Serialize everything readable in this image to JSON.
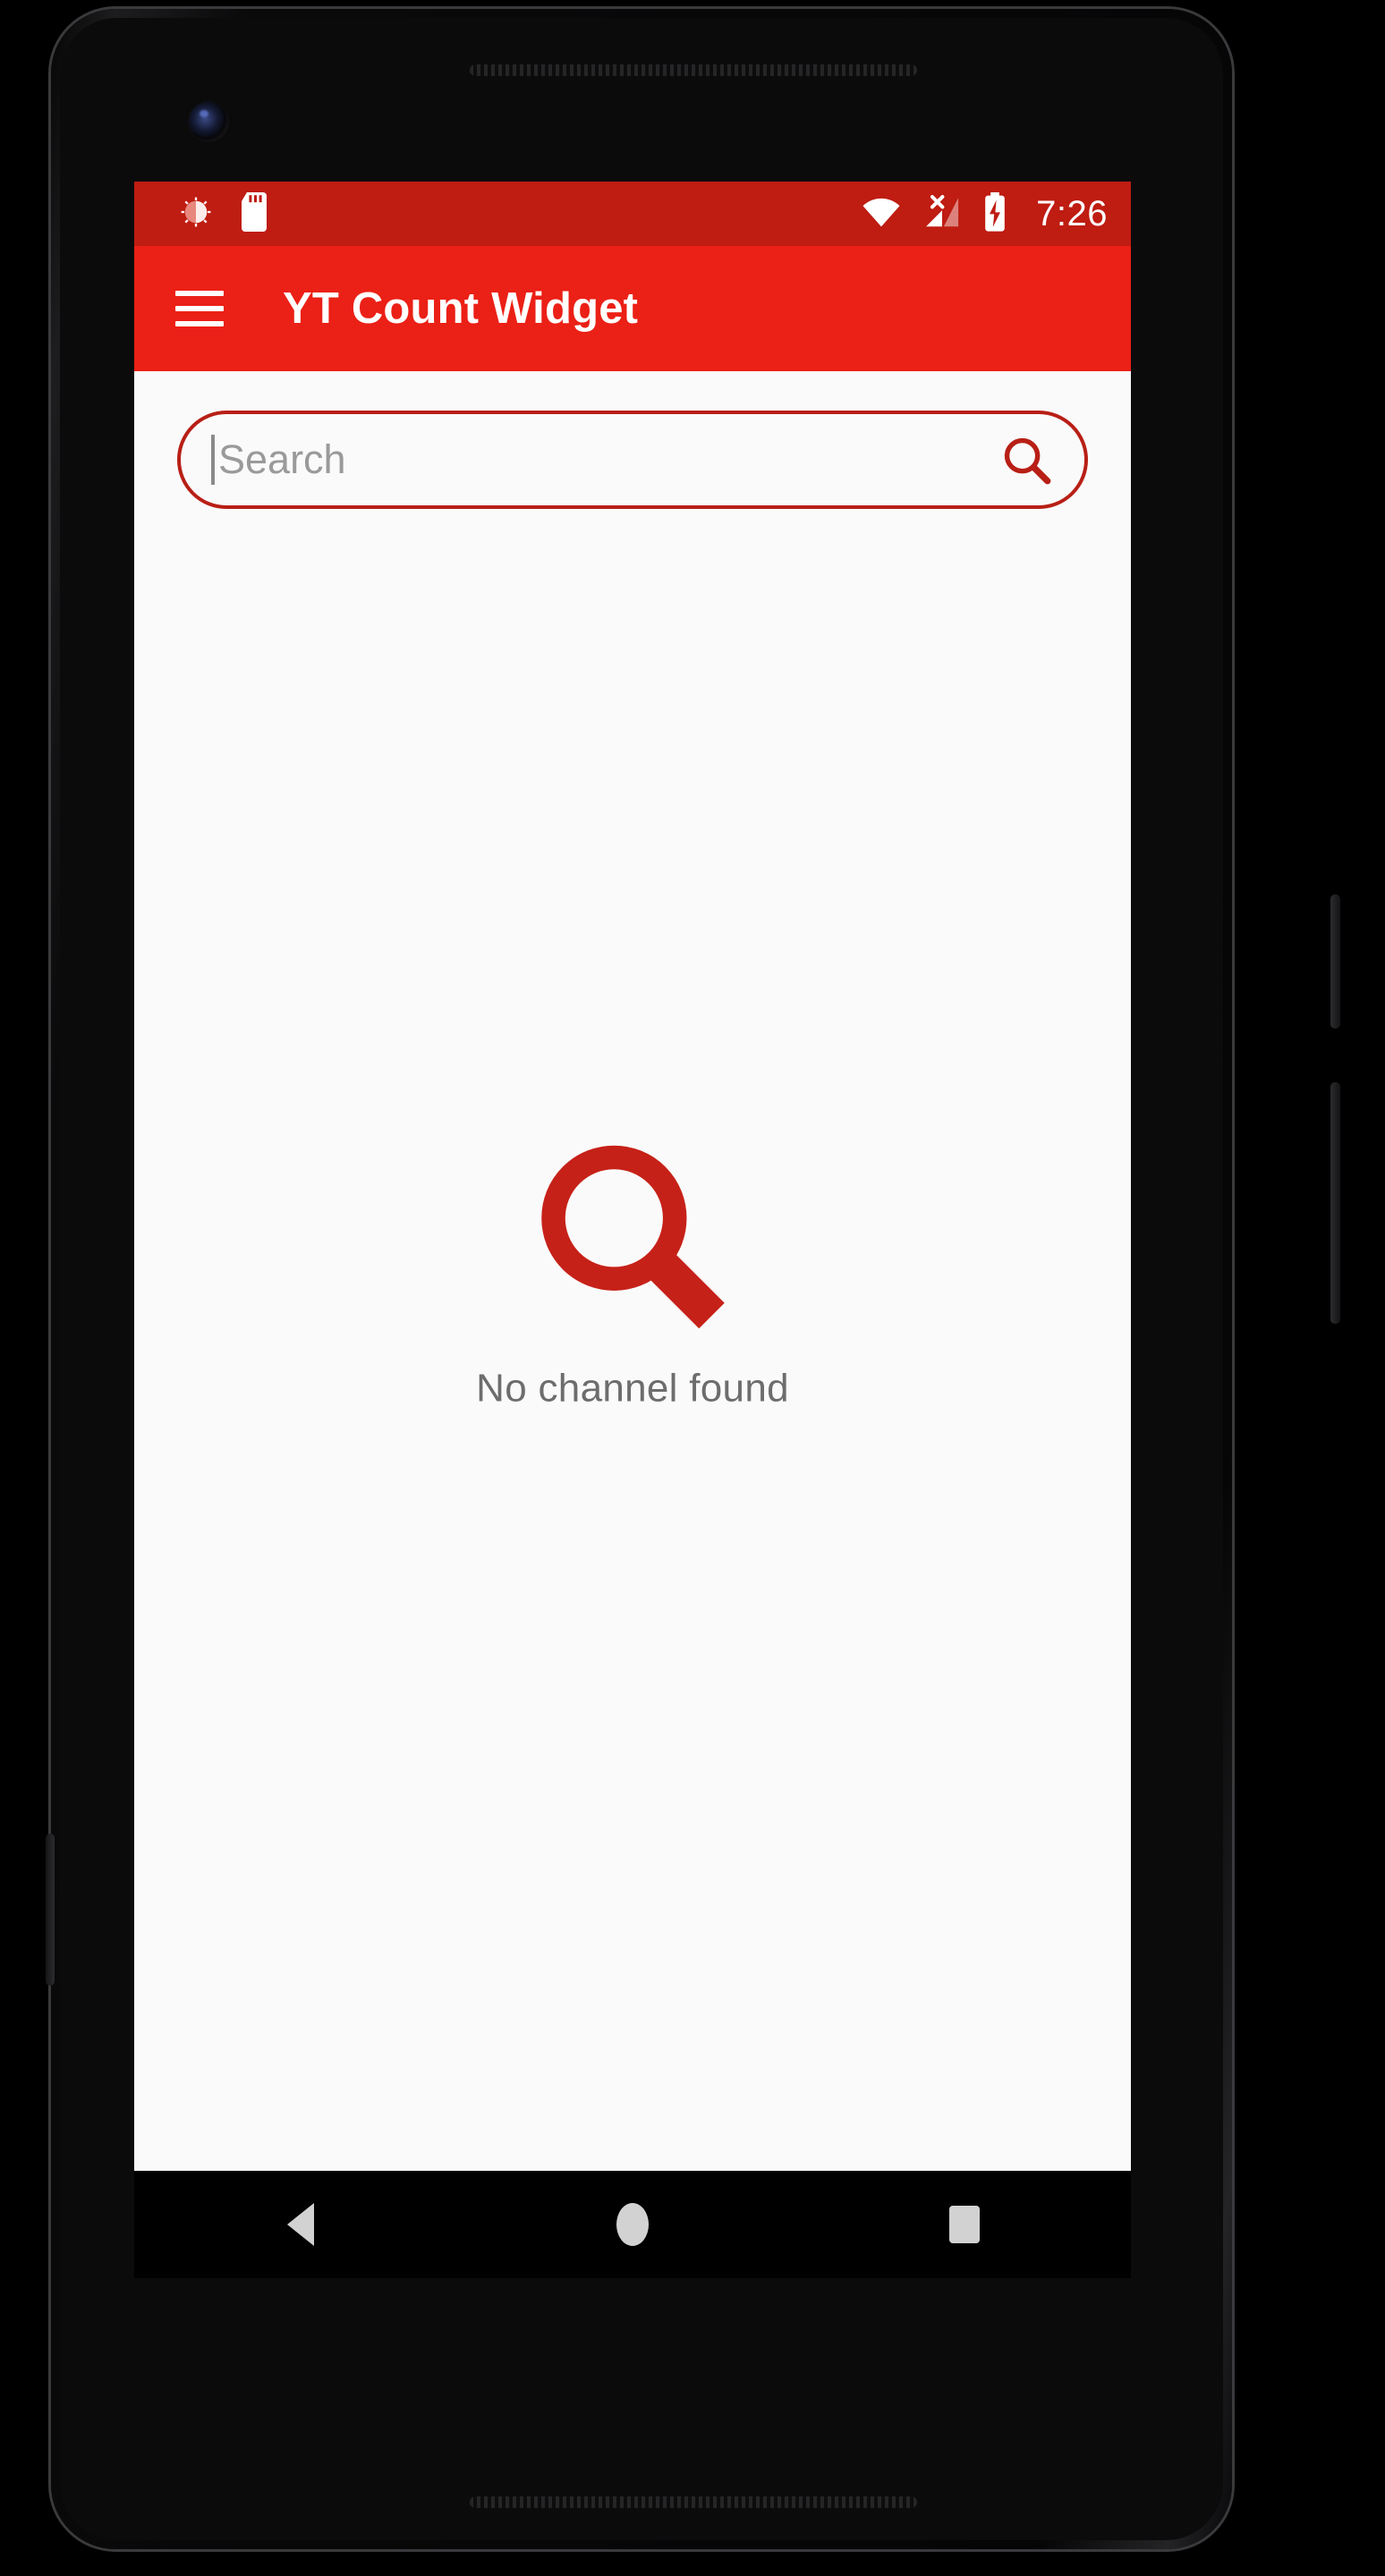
{
  "device": {
    "name": "android-phone-frame",
    "camera": "front-camera"
  },
  "status_bar": {
    "background": "#bf1c12",
    "time": "7:26",
    "notification_icons": [
      {
        "name": "sync-brightness-icon",
        "label": "notification"
      },
      {
        "name": "sd-card-icon",
        "label": "sd card"
      }
    ],
    "system_icons": [
      {
        "name": "wifi-icon",
        "label": "wifi"
      },
      {
        "name": "cellular-no-sim-icon",
        "label": "no sim"
      },
      {
        "name": "battery-charging-icon",
        "label": "battery charging"
      }
    ]
  },
  "app_bar": {
    "background": "#eb2016",
    "menu_label": "menu",
    "title": "YT Count Widget"
  },
  "search": {
    "placeholder": "Search",
    "value": "",
    "border_color": "#b81f16",
    "icon": "search-icon"
  },
  "empty_state": {
    "icon": "search-icon",
    "icon_color": "#c62118",
    "message": "No channel found"
  },
  "nav_bar": {
    "background": "#000000",
    "buttons": [
      {
        "name": "nav-back-button",
        "label": "Back"
      },
      {
        "name": "nav-home-button",
        "label": "Home"
      },
      {
        "name": "nav-recents-button",
        "label": "Recents"
      }
    ]
  },
  "colors": {
    "brand_red": "#eb2016",
    "status_red": "#bf1c12",
    "accent_red": "#c62118",
    "screen_bg": "#fafafa",
    "muted_text": "#6d6d6d"
  }
}
